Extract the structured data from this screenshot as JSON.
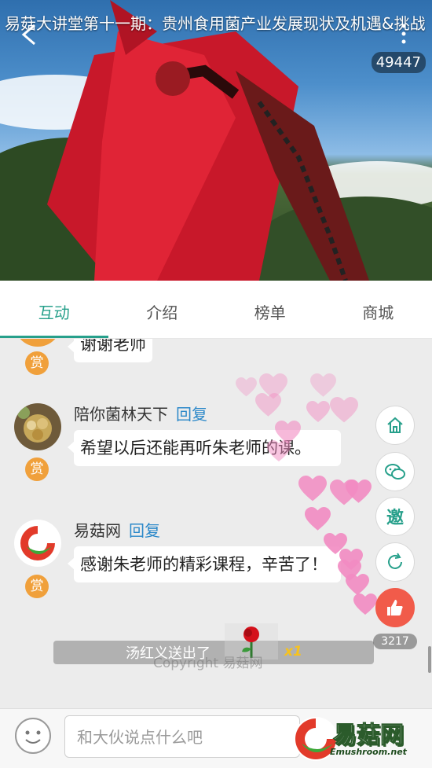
{
  "video": {
    "title": "易菇大讲堂第十一期：贵州食用菌产业发展现状及机遇&挑战",
    "view_count": "49447"
  },
  "tabs": [
    {
      "label": "互动",
      "active": true
    },
    {
      "label": "介绍",
      "active": false
    },
    {
      "label": "榜单",
      "active": false
    },
    {
      "label": "商城",
      "active": false
    }
  ],
  "chat": {
    "reward_label": "赏",
    "reply_label": "回复",
    "messages": [
      {
        "name": "",
        "text": "谢谢老师"
      },
      {
        "name": "陪你菌林天下",
        "text": "希望以后还能再听朱老师的课。"
      },
      {
        "name": "易菇网",
        "text": "感谢朱老师的精彩课程，辛苦了！"
      }
    ]
  },
  "side_tools": {
    "invite_label": "邀",
    "like_count": "3217",
    "icons": [
      "home-icon",
      "wechat-icon",
      "invite-icon",
      "refresh-icon",
      "thumbs-up-icon"
    ]
  },
  "gift": {
    "text": "汤红义送出了",
    "count": "x1",
    "watermark": "Copyright 易菇网"
  },
  "input": {
    "placeholder": "和大伙说点什么吧"
  },
  "logo": {
    "cn": "易菇网",
    "en": "Emushroom.net"
  },
  "colors": {
    "accent": "#27a08b",
    "reply": "#2b88c9",
    "reward": "#f0a03b",
    "like": "#f15b4a",
    "heart": "#f28bc2"
  }
}
